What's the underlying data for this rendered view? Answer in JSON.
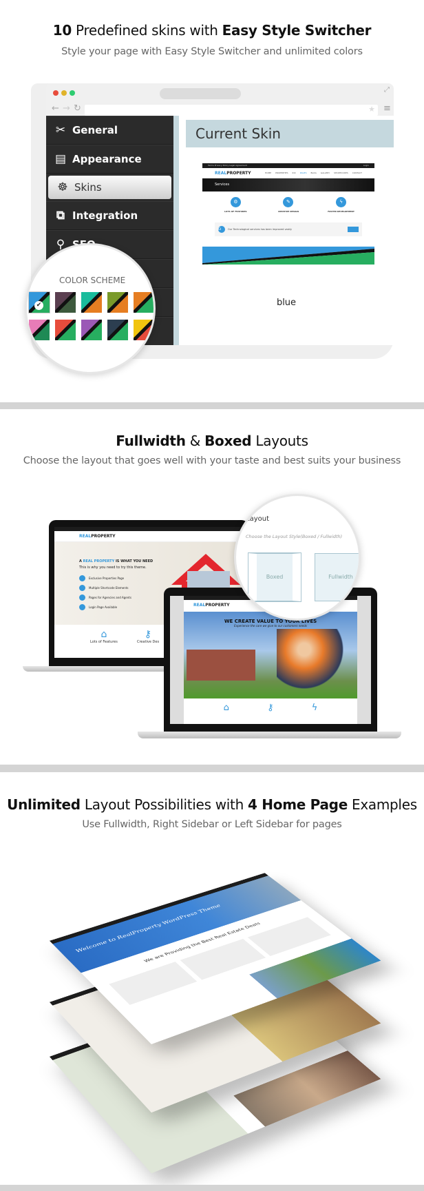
{
  "section1": {
    "title_num": "10",
    "title_mid": " Predefined skins with ",
    "title_bold": "Easy Style Switcher",
    "subtitle": "Style your page with Easy Style Switcher and unlimited colors",
    "sidebar": [
      {
        "label": "General",
        "icon": "wrench-screwdriver-icon",
        "glyph": "✂"
      },
      {
        "label": "Appearance",
        "icon": "newspaper-icon",
        "glyph": "▤"
      },
      {
        "label": "Skins",
        "icon": "ship-wheel-icon",
        "glyph": "☸",
        "active": true
      },
      {
        "label": "Integration",
        "icon": "window-cursor-icon",
        "glyph": "⧉"
      },
      {
        "label": "SEO",
        "icon": "search-icon",
        "glyph": "⚲"
      }
    ],
    "panel_title": "Current Skin",
    "skin_name": "blue",
    "color_scheme_label": "COLOR SCHEME",
    "swatches": [
      {
        "a": "#3498db",
        "b": "#27ae60",
        "selected": true
      },
      {
        "a": "#5b3f50",
        "b": "#3d5a3d"
      },
      {
        "a": "#1abc9c",
        "b": "#e67e22"
      },
      {
        "a": "#7a9a2a",
        "b": "#e67e22"
      },
      {
        "a": "#e67e22",
        "b": "#27ae60"
      },
      {
        "a": "#e87cb7",
        "b": "#1e8a55"
      },
      {
        "a": "#e74c3c",
        "b": "#27ae60"
      },
      {
        "a": "#9b59b6",
        "b": "#27ae60"
      },
      {
        "a": "#2c3e50",
        "b": "#27ae60"
      },
      {
        "a": "#f1c40f",
        "b": "#e74c3c"
      }
    ],
    "preview": {
      "top_links": "Terms  Privacy Policy  Legal Agreement",
      "login": "Login",
      "logo_a": "REAL",
      "logo_b": "PROPERTY",
      "nav": [
        "HOME",
        "PROPERTIES",
        "IDX",
        "PAGES",
        "BLOG",
        "GALLERY",
        "SHORTCODES",
        "CONTACT"
      ],
      "banner": "Services",
      "features": [
        {
          "title": "LOTS OF FEATURES",
          "glyph": "⚙"
        },
        {
          "title": "CREATIVE DESIGN",
          "glyph": "✎"
        },
        {
          "title": "FASTER DEVELOPMENT",
          "glyph": "ϟ"
        }
      ],
      "callout": "Our Technological services has been improved vastly"
    }
  },
  "section2": {
    "title_bold1": "Fullwidth",
    "title_amp": " & ",
    "title_bold2": "Boxed",
    "title_rest": " Layouts",
    "subtitle": "Choose the layout that goes well with your taste and best suits your business",
    "back_screen": {
      "heading_a": "A ",
      "heading_b": "REAL PROPERTY",
      "heading_c": " IS WHAT YOU NEED",
      "sub": "This is why you need to try this theme.",
      "list": [
        "Exclusive Properties Page",
        "Multiple Shortcode Elements",
        "Pages for Agencies and Agents",
        "Login Page Available"
      ],
      "features": [
        "Lots of Features",
        "Creative Des"
      ]
    },
    "front_screen": {
      "heading": "WE CREATE VALUE TO YOUR LIVES",
      "sub": "Experience the care we give to our customers needs"
    },
    "magnifier": {
      "label": "Layout",
      "hint": "Choose the Layout Style(Boxed / Fullwidth)",
      "options": [
        "Boxed",
        "Fullwidth"
      ]
    }
  },
  "section3": {
    "title_bold1": "Unlimited",
    "title_mid": " Layout Possibilities with ",
    "title_bold2": "4 Home Page",
    "title_rest": " Examples",
    "subtitle": "Use Fullwidth, Right Sidebar or Left Sidebar for pages",
    "top_layer": {
      "welcome": "Welcome to RealProperty WordPress Theme",
      "deals": "We are Providing the Best Real Estate Deals"
    }
  },
  "colors": {
    "accent": "#3498db",
    "sidebar": "#2b2b2b",
    "panel_header": "#c5d8de",
    "divider": "#d4d4d4"
  }
}
